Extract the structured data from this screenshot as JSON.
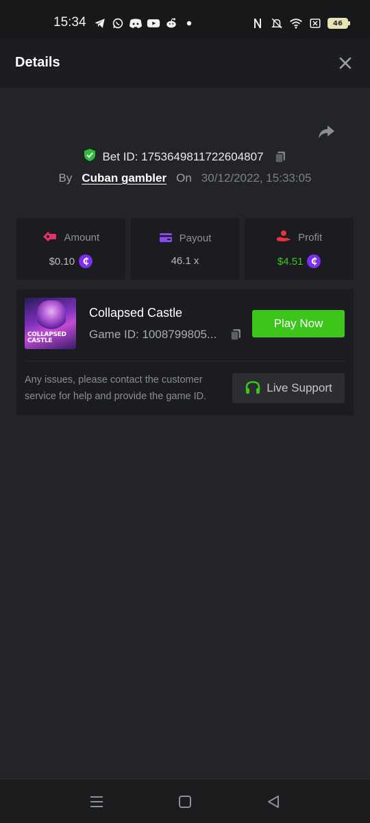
{
  "status_bar": {
    "time": "15:34",
    "battery": "46",
    "left_icons": [
      "telegram-icon",
      "whatsapp-icon",
      "discord-icon",
      "youtube-icon",
      "reddit-icon",
      "dot-icon"
    ],
    "right_icons": [
      "nfc-icon",
      "mute-icon",
      "wifi-icon",
      "sim-off-icon",
      "battery-icon"
    ]
  },
  "header": {
    "title": "Details"
  },
  "bet": {
    "bet_id_label": "Bet ID: 1753649811722604807",
    "by_label": "By",
    "user": "Cuban gambler",
    "on_label": "On",
    "date": "30/12/2022, 15:33:05"
  },
  "stats": [
    {
      "label": "Amount",
      "value": "$0.10",
      "icon": "amount-icon",
      "coin": true
    },
    {
      "label": "Payout",
      "value": "46.1 x",
      "icon": "wallet-icon",
      "coin": false
    },
    {
      "label": "Profit",
      "value": "$4.51",
      "icon": "profit-icon",
      "coin": true
    }
  ],
  "game": {
    "name": "Collapsed Castle",
    "id_label": "Game ID: 1008799805...",
    "thumb_text": "COLLAPSED CASTLE",
    "play_label": "Play Now"
  },
  "support": {
    "text": "Any issues, please contact the customer service for help and provide the game ID.",
    "button_label": "Live Support"
  },
  "coin_symbol": "₵",
  "colors": {
    "accent_green": "#3cc61c",
    "profit_green": "#3fc71d",
    "coin_purple": "#7d2df0",
    "shield_green": "#2fbe3a",
    "amount_pink": "#e2336b",
    "wallet_purple": "#8a48f0",
    "profit_red": "#e2333f"
  }
}
